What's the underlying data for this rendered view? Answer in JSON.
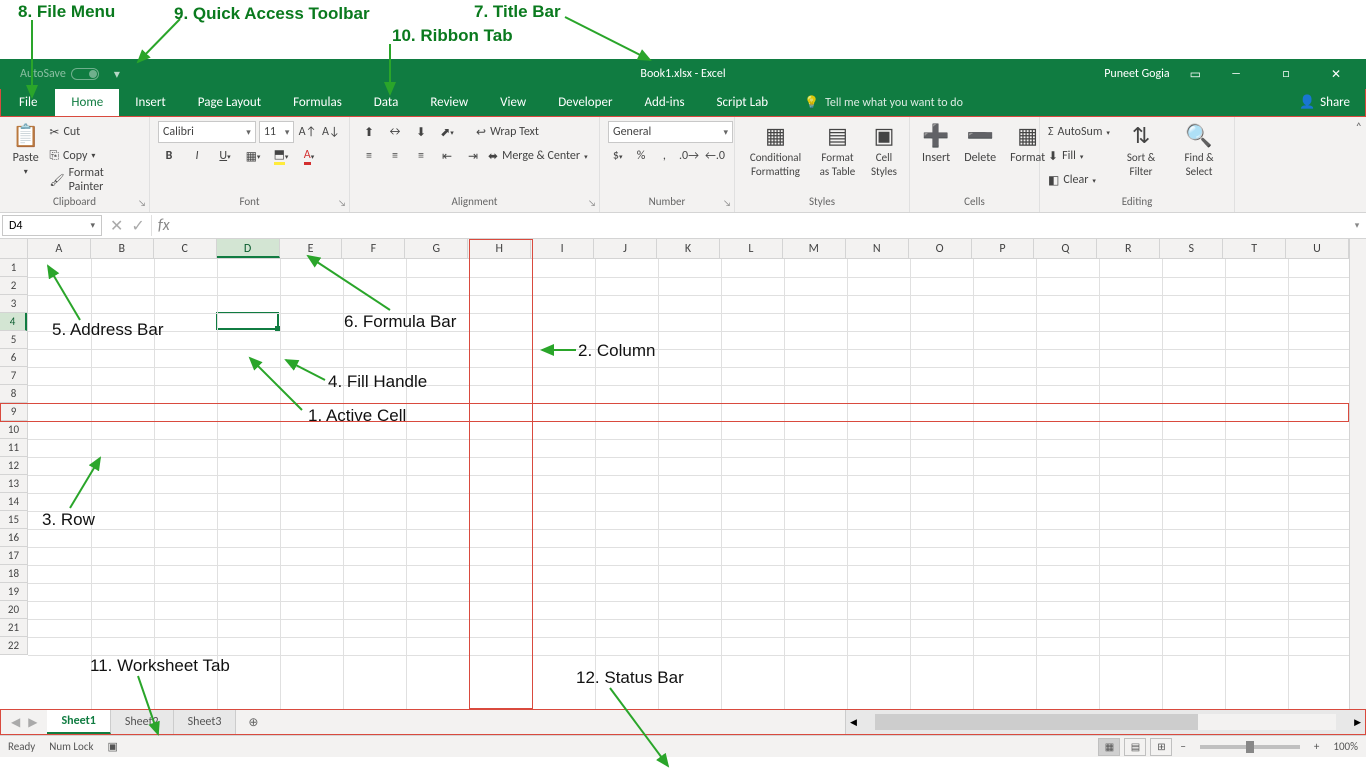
{
  "titlebar": {
    "autosave_label": "AutoSave",
    "autosave_state": "Off",
    "title": "Book1.xlsx - Excel",
    "user": "Puneet Gogia"
  },
  "ribbon_tabs": [
    "File",
    "Home",
    "Insert",
    "Page Layout",
    "Formulas",
    "Data",
    "Review",
    "View",
    "Developer",
    "Add-ins",
    "Script Lab"
  ],
  "active_ribbon_tab": "Home",
  "tellme_placeholder": "Tell me what you want to do",
  "share_label": "Share",
  "ribbon": {
    "clipboard": {
      "paste": "Paste",
      "cut": "Cut",
      "copy": "Copy",
      "format_painter": "Format Painter",
      "group": "Clipboard"
    },
    "font": {
      "name": "Calibri",
      "size": "11",
      "group": "Font"
    },
    "alignment": {
      "wrap": "Wrap Text",
      "merge": "Merge & Center",
      "group": "Alignment"
    },
    "number": {
      "format": "General",
      "group": "Number"
    },
    "styles": {
      "cond": "Conditional Formatting",
      "table": "Format as Table",
      "cell": "Cell Styles",
      "group": "Styles"
    },
    "cells": {
      "insert": "Insert",
      "delete": "Delete",
      "format": "Format",
      "group": "Cells"
    },
    "editing": {
      "autosum": "AutoSum",
      "fill": "Fill",
      "clear": "Clear",
      "sort": "Sort & Filter",
      "find": "Find & Select",
      "group": "Editing"
    }
  },
  "namebox": {
    "cell_ref": "D4",
    "fx": "fx"
  },
  "columns": [
    "A",
    "B",
    "C",
    "D",
    "E",
    "F",
    "G",
    "H",
    "I",
    "J",
    "K",
    "L",
    "M",
    "N",
    "O",
    "P",
    "Q",
    "R",
    "S",
    "T",
    "U"
  ],
  "rows_count": 22,
  "active_cell": {
    "col": "D",
    "row": 4,
    "col_index": 3,
    "row_index": 3
  },
  "sheets": [
    "Sheet1",
    "Sheet2",
    "Sheet3"
  ],
  "active_sheet": "Sheet1",
  "statusbar": {
    "ready": "Ready",
    "numlock": "Num Lock",
    "zoom": "100%"
  },
  "annotations": {
    "a1": "1. Active Cell",
    "a2": "2. Column",
    "a3": "3. Row",
    "a4": "4. Fill Handle",
    "a5": "5. Address Bar",
    "a6": "6. Formula Bar",
    "a7": "7. Title Bar",
    "a8": "8. File Menu",
    "a9": "9. Quick Access Toolbar",
    "a10": "10. Ribbon Tab",
    "a11": "11. Worksheet Tab",
    "a12": "12. Status Bar"
  }
}
